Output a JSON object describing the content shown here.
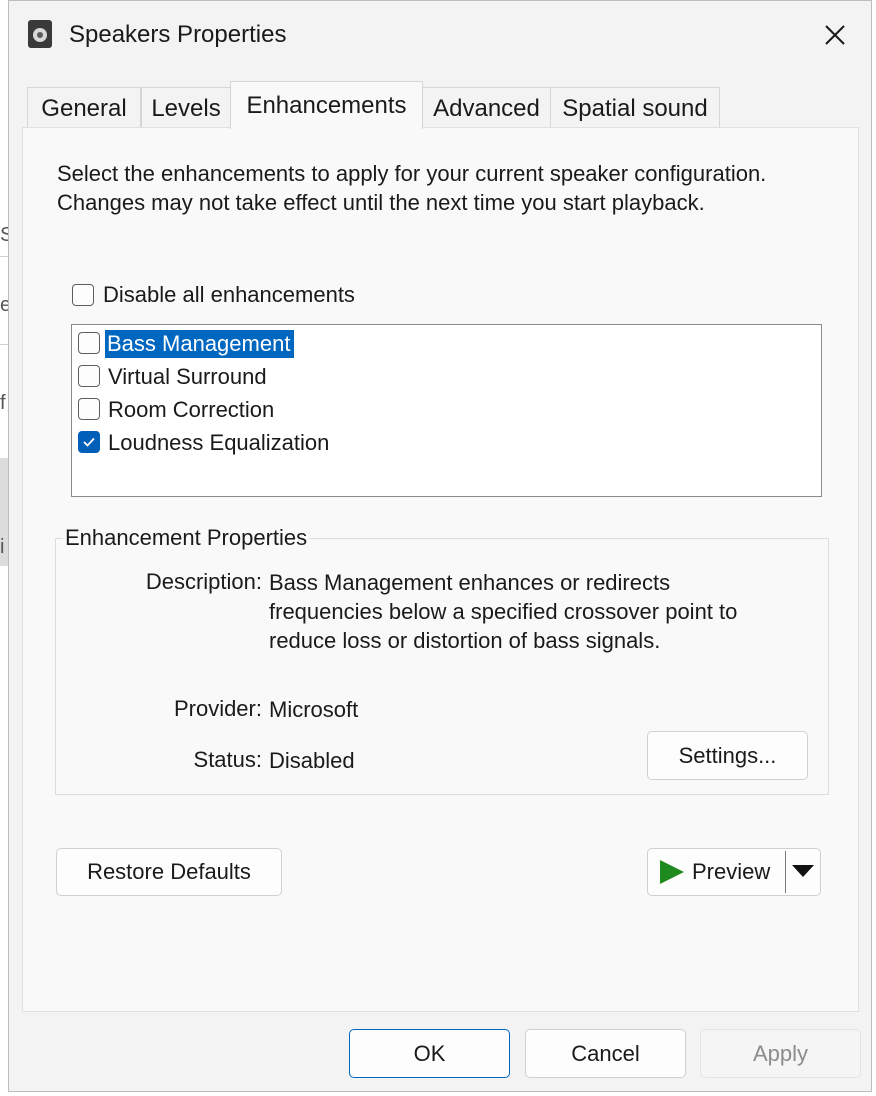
{
  "window": {
    "title": "Speakers Properties"
  },
  "background": {
    "letters": [
      "S",
      "e",
      "f",
      "i"
    ]
  },
  "tabs": [
    {
      "label": "General"
    },
    {
      "label": "Levels"
    },
    {
      "label": "Enhancements"
    },
    {
      "label": "Advanced"
    },
    {
      "label": "Spatial sound"
    }
  ],
  "active_tab": "Enhancements",
  "intro_text": "Select the enhancements to apply for your current speaker configuration. Changes may not take effect until the next time you start playback.",
  "disable_all": {
    "label": "Disable all enhancements",
    "checked": false
  },
  "enhancements": [
    {
      "label": "Bass Management",
      "checked": false,
      "selected": true
    },
    {
      "label": "Virtual Surround",
      "checked": false,
      "selected": false
    },
    {
      "label": "Room Correction",
      "checked": false,
      "selected": false
    },
    {
      "label": "Loudness Equalization",
      "checked": true,
      "selected": false
    }
  ],
  "properties": {
    "group_title": "Enhancement Properties",
    "description_key": "Description:",
    "description_lines": [
      "Bass Management enhances or redirects",
      "frequencies below a specified crossover point to",
      "reduce loss or distortion of bass signals."
    ],
    "provider_key": "Provider:",
    "provider_value": "Microsoft",
    "status_key": "Status:",
    "status_value": "Disabled",
    "settings_button": "Settings..."
  },
  "buttons": {
    "restore_defaults": "Restore Defaults",
    "preview": "Preview",
    "ok": "OK",
    "cancel": "Cancel",
    "apply": "Apply"
  },
  "colors": {
    "accent": "#005fb8",
    "selection": "#0067c0",
    "preview_play": "#1e8a1e"
  }
}
